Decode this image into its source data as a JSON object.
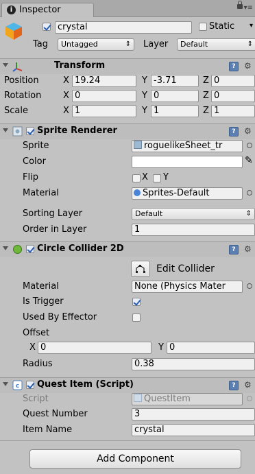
{
  "window": {
    "tab_label": "Inspector"
  },
  "gameobject": {
    "active": true,
    "name": "crystal",
    "static_label": "Static",
    "static_checked": false,
    "tag_label": "Tag",
    "tag_value": "Untagged",
    "layer_label": "Layer",
    "layer_value": "Default"
  },
  "transform": {
    "title": "Transform",
    "rows": [
      {
        "label": "Position",
        "x": "19.24",
        "y": "-3.71",
        "z": "0"
      },
      {
        "label": "Rotation",
        "x": "0",
        "y": "0",
        "z": "0"
      },
      {
        "label": "Scale",
        "x": "1",
        "y": "1",
        "z": "1"
      }
    ],
    "axis": {
      "x": "X",
      "y": "Y",
      "z": "Z"
    }
  },
  "sprite_renderer": {
    "title": "Sprite Renderer",
    "enabled": true,
    "sprite_label": "Sprite",
    "sprite_value": "roguelikeSheet_tr",
    "color_label": "Color",
    "color_value": "#ffffff",
    "flip_label": "Flip",
    "flip_x": "X",
    "flip_y": "Y",
    "material_label": "Material",
    "material_value": "Sprites-Default",
    "sorting_layer_label": "Sorting Layer",
    "sorting_layer_value": "Default",
    "order_label": "Order in Layer",
    "order_value": "1"
  },
  "circle_collider": {
    "title": "Circle Collider 2D",
    "enabled": true,
    "edit_label": "Edit Collider",
    "material_label": "Material",
    "material_value": "None (Physics Mater",
    "trigger_label": "Is Trigger",
    "trigger_checked": true,
    "effector_label": "Used By Effector",
    "effector_checked": false,
    "offset_label": "Offset",
    "offset_x_axis": "X",
    "offset_x": "0",
    "offset_y_axis": "Y",
    "offset_y": "0",
    "radius_label": "Radius",
    "radius_value": "0.38"
  },
  "quest_item": {
    "title": "Quest Item (Script)",
    "enabled": true,
    "script_label": "Script",
    "script_value": "QuestItem",
    "quest_number_label": "Quest Number",
    "quest_number_value": "3",
    "item_name_label": "Item Name",
    "item_name_value": "crystal"
  },
  "add_component_label": "Add Component",
  "colors": {
    "panel": "#c2c2c2",
    "header": "#bdbdbd",
    "accent": "#2a5db0"
  }
}
